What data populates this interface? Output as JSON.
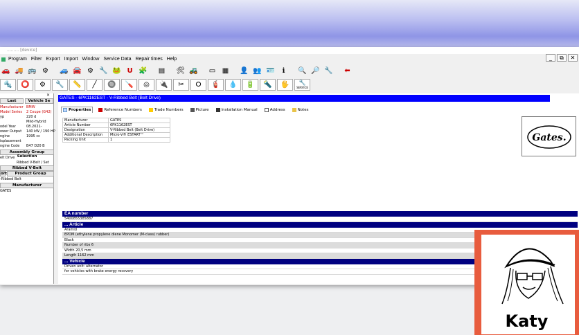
{
  "window": {
    "title": "......... [device]",
    "controls": [
      "_",
      "⧉",
      "✕"
    ]
  },
  "menu": [
    "Program",
    "Filter",
    "Export",
    "Import",
    "Window",
    "Service Data",
    "Repair times",
    "Help"
  ],
  "toolbar": {
    "service_label": "SERVICE"
  },
  "sidebar": {
    "close": "×",
    "tabs": [
      "Last",
      "Vehicle Se"
    ],
    "vehicle": [
      {
        "key": "Manufacturer",
        "value": "BMW",
        "red": true
      },
      {
        "key": "Model Series",
        "value": "2 Coupe (G42)",
        "red": true
      },
      {
        "key": "yp",
        "value": "220 d"
      },
      {
        "key": "",
        "value": "Mild-Hybrid"
      },
      {
        "key": "odel Year",
        "value": "08.2021-"
      },
      {
        "key": "ower Output",
        "value": "140 kW / 190 HP"
      },
      {
        "key": "ngine",
        "value": "1995 cc"
      },
      {
        "key": "isplacement",
        "value": ""
      },
      {
        "key": "ngine Code",
        "value": "B47 D20 B"
      }
    ],
    "assembly_header": "Assembly Group Selection",
    "assembly_items": [
      "elt Drive",
      "Ribbed V-Belt / Set"
    ],
    "selected_group": "Ribbed V-Belt",
    "product_group_label": "Product Group",
    "product_group_prefix": "ort",
    "product_item": "-Ribbed Belt",
    "manufacturer_header": "Manufacturer",
    "manufacturer_item": "GATES"
  },
  "main": {
    "bar_title": "GATES  -  6PK1162EST  -  V-Ribbed Belt (Belt Drive)",
    "tabs": [
      "Properties",
      "Reference Numbers",
      "Trade Numbers",
      "Picture",
      "Installation Manual",
      "Address",
      "Notes"
    ],
    "properties": [
      {
        "label": "Manufacturer",
        "value": "GATES"
      },
      {
        "label": "Article Number",
        "value": "6PK1162EST"
      },
      {
        "label": "Designation",
        "value": "V-Ribbed Belt (Belt Drive)"
      },
      {
        "label": "Additional Description",
        "value": "Micro-V® ESTART™"
      },
      {
        "label": "Packing Unit",
        "value": "1"
      }
    ],
    "logo_text": "Gates.",
    "sections": {
      "ea_header": "EA number",
      "ea_value": "5400855385887",
      "article_header": "... Article",
      "article_rows": [
        "Aramid",
        "EPDM (ethylene propylene diene Monomer (M-class) rubber)",
        "Black",
        "Number of ribs 6",
        "Width 20,5 mm",
        "Length 1162 mm"
      ],
      "vehicle_header": "... Vehicle",
      "vehicle_rows": [
        "Driven unit: alternator",
        "for vehicles with brake energy recovery"
      ]
    }
  },
  "avatar": {
    "name": "Katy",
    "bg_color": "#e85c3e"
  }
}
